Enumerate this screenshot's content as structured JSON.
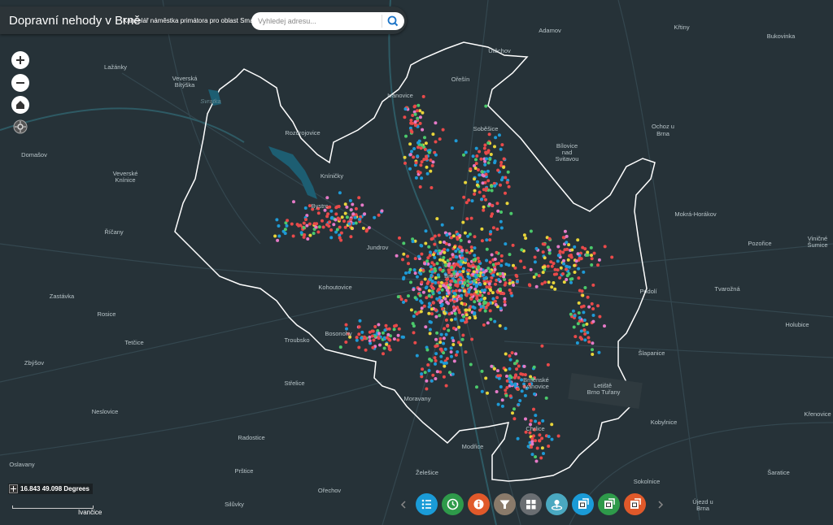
{
  "header": {
    "title": "Dopravní nehody v Brně",
    "subtitle": "Kancelář náměstka primátora pro oblast Smart City",
    "search_placeholder": "Vyhledej adresu..."
  },
  "map": {
    "labels": [
      {
        "text": "Adamov"
      },
      {
        "text": "Křtiny"
      },
      {
        "text": "Bukovinka"
      },
      {
        "text": "Útěchov"
      },
      {
        "text": "Ořešín"
      },
      {
        "text": "Lažánky"
      },
      {
        "text": "Veverská"
      },
      {
        "text": "Bítýška"
      },
      {
        "text": "Ivanovice"
      },
      {
        "text": "Soběšice"
      },
      {
        "text": "Rozdrojovice"
      },
      {
        "text": "Ochoz u"
      },
      {
        "text": "Brna"
      },
      {
        "text": "Domašov"
      },
      {
        "text": "Bílovice"
      },
      {
        "text": "nad"
      },
      {
        "text": "Svitavou"
      },
      {
        "text": "Kníničky"
      },
      {
        "text": "Veverské"
      },
      {
        "text": "Knínice"
      },
      {
        "text": "Bystrc"
      },
      {
        "text": "Mokrá-Horákov"
      },
      {
        "text": "Říčany"
      },
      {
        "text": "Jundrov"
      },
      {
        "text": "Pozořice"
      },
      {
        "text": "Viničné"
      },
      {
        "text": "Šumice"
      },
      {
        "text": "Kohoutovice"
      },
      {
        "text": "Podolí"
      },
      {
        "text": "Tvarožná"
      },
      {
        "text": "Zastávka"
      },
      {
        "text": "Rosice"
      },
      {
        "text": "Holubice"
      },
      {
        "text": "Bosonohy"
      },
      {
        "text": "Troubsko"
      },
      {
        "text": "Tetčice"
      },
      {
        "text": "Šlapanice"
      },
      {
        "text": "Zbýšov"
      },
      {
        "text": "Střelice"
      },
      {
        "text": "Brněnské"
      },
      {
        "text": "Ivanovice"
      },
      {
        "text": "Letiště"
      },
      {
        "text": "Brno Tuřany"
      },
      {
        "text": "Moravany"
      },
      {
        "text": "Neslovice"
      },
      {
        "text": "Kobylnice"
      },
      {
        "text": "Křenovice"
      },
      {
        "text": "Chrlice"
      },
      {
        "text": "Radostice"
      },
      {
        "text": "Modřice"
      },
      {
        "text": "Oslavany"
      },
      {
        "text": "Prštice"
      },
      {
        "text": "Želešice"
      },
      {
        "text": "Šaratice"
      },
      {
        "text": "Sokolnice"
      },
      {
        "text": "Ořechov"
      },
      {
        "text": "Silůvky"
      },
      {
        "text": "Újezd u"
      },
      {
        "text": "Brna"
      },
      {
        "text": "Brno"
      },
      {
        "text": "Svratka"
      }
    ]
  },
  "coordinates": {
    "value": "16.843 49.098 Degrees"
  },
  "scale": {
    "label": "Ivančice"
  },
  "toolbar": {
    "buttons": [
      {
        "name": "legend-button",
        "icon": "list-icon",
        "color": "#1a9bd7"
      },
      {
        "name": "history-button",
        "icon": "clock-icon",
        "color": "#2e9a4a"
      },
      {
        "name": "info-button",
        "icon": "info-icon",
        "color": "#e0592a"
      },
      {
        "name": "filter-button",
        "icon": "filter-icon",
        "color": "#8a7a6a"
      },
      {
        "name": "layout-button",
        "icon": "grid-icon",
        "color": "#6a6e72"
      },
      {
        "name": "geo-button",
        "icon": "pin-icon",
        "color": "#4aa8c0"
      },
      {
        "name": "export-blue-button",
        "icon": "export-icon",
        "color": "#1a9bd7"
      },
      {
        "name": "export-green-button",
        "icon": "export-icon",
        "color": "#2e9a4a"
      },
      {
        "name": "export-orange-button",
        "icon": "export-icon",
        "color": "#e0592a"
      }
    ]
  },
  "colors": {
    "background": "#263238",
    "boundary": "#ffffff",
    "water": "#1d5e72",
    "accident_red": "#e94a4a",
    "accident_blue": "#1e9ad6",
    "accident_yellow": "#e8d53a",
    "accident_green": "#4bc96b",
    "accident_pink": "#e67ac8"
  }
}
